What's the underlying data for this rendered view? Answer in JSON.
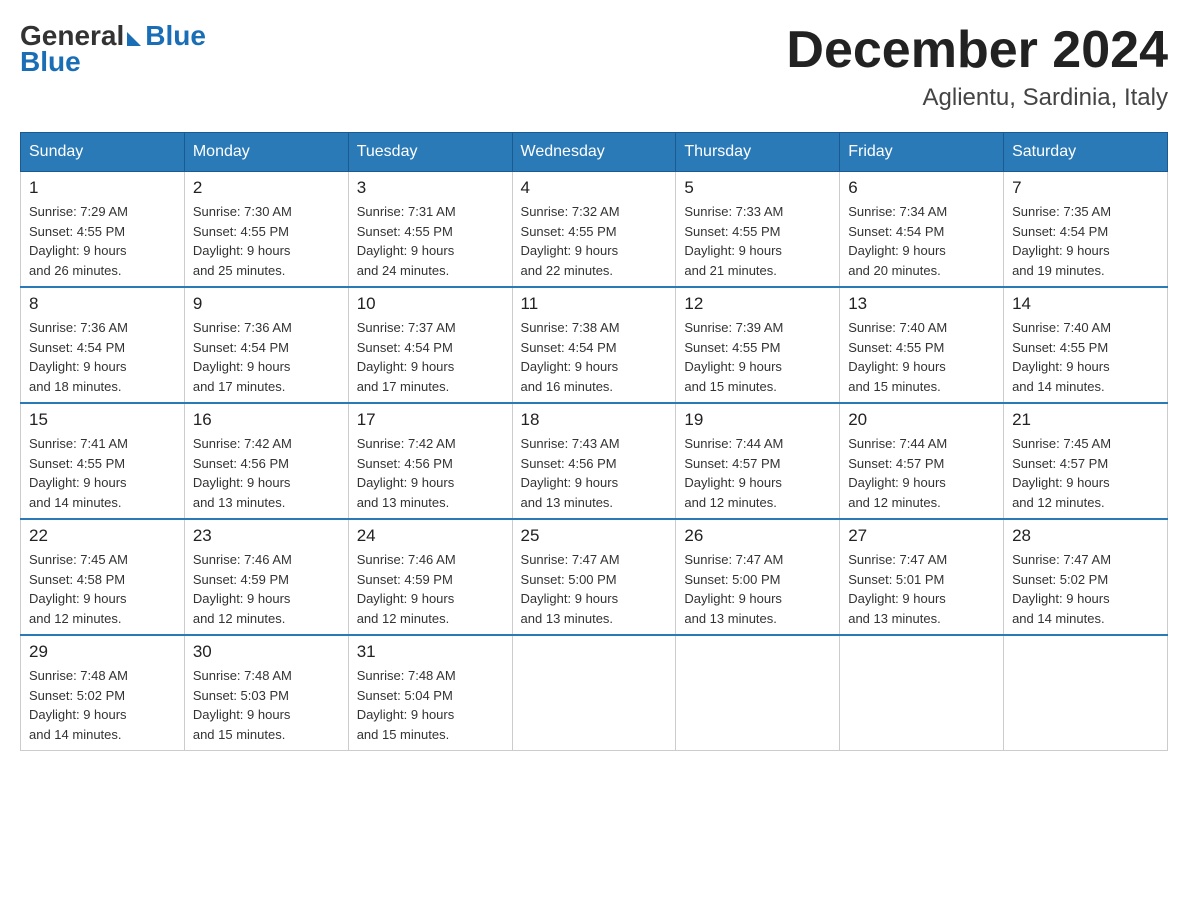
{
  "logo": {
    "general": "General",
    "blue": "Blue"
  },
  "header": {
    "month": "December 2024",
    "location": "Aglientu, Sardinia, Italy"
  },
  "days_of_week": [
    "Sunday",
    "Monday",
    "Tuesday",
    "Wednesday",
    "Thursday",
    "Friday",
    "Saturday"
  ],
  "weeks": [
    [
      {
        "day": "1",
        "sunrise": "7:29 AM",
        "sunset": "4:55 PM",
        "daylight": "9 hours and 26 minutes."
      },
      {
        "day": "2",
        "sunrise": "7:30 AM",
        "sunset": "4:55 PM",
        "daylight": "9 hours and 25 minutes."
      },
      {
        "day": "3",
        "sunrise": "7:31 AM",
        "sunset": "4:55 PM",
        "daylight": "9 hours and 24 minutes."
      },
      {
        "day": "4",
        "sunrise": "7:32 AM",
        "sunset": "4:55 PM",
        "daylight": "9 hours and 22 minutes."
      },
      {
        "day": "5",
        "sunrise": "7:33 AM",
        "sunset": "4:55 PM",
        "daylight": "9 hours and 21 minutes."
      },
      {
        "day": "6",
        "sunrise": "7:34 AM",
        "sunset": "4:54 PM",
        "daylight": "9 hours and 20 minutes."
      },
      {
        "day": "7",
        "sunrise": "7:35 AM",
        "sunset": "4:54 PM",
        "daylight": "9 hours and 19 minutes."
      }
    ],
    [
      {
        "day": "8",
        "sunrise": "7:36 AM",
        "sunset": "4:54 PM",
        "daylight": "9 hours and 18 minutes."
      },
      {
        "day": "9",
        "sunrise": "7:36 AM",
        "sunset": "4:54 PM",
        "daylight": "9 hours and 17 minutes."
      },
      {
        "day": "10",
        "sunrise": "7:37 AM",
        "sunset": "4:54 PM",
        "daylight": "9 hours and 17 minutes."
      },
      {
        "day": "11",
        "sunrise": "7:38 AM",
        "sunset": "4:54 PM",
        "daylight": "9 hours and 16 minutes."
      },
      {
        "day": "12",
        "sunrise": "7:39 AM",
        "sunset": "4:55 PM",
        "daylight": "9 hours and 15 minutes."
      },
      {
        "day": "13",
        "sunrise": "7:40 AM",
        "sunset": "4:55 PM",
        "daylight": "9 hours and 15 minutes."
      },
      {
        "day": "14",
        "sunrise": "7:40 AM",
        "sunset": "4:55 PM",
        "daylight": "9 hours and 14 minutes."
      }
    ],
    [
      {
        "day": "15",
        "sunrise": "7:41 AM",
        "sunset": "4:55 PM",
        "daylight": "9 hours and 14 minutes."
      },
      {
        "day": "16",
        "sunrise": "7:42 AM",
        "sunset": "4:56 PM",
        "daylight": "9 hours and 13 minutes."
      },
      {
        "day": "17",
        "sunrise": "7:42 AM",
        "sunset": "4:56 PM",
        "daylight": "9 hours and 13 minutes."
      },
      {
        "day": "18",
        "sunrise": "7:43 AM",
        "sunset": "4:56 PM",
        "daylight": "9 hours and 13 minutes."
      },
      {
        "day": "19",
        "sunrise": "7:44 AM",
        "sunset": "4:57 PM",
        "daylight": "9 hours and 12 minutes."
      },
      {
        "day": "20",
        "sunrise": "7:44 AM",
        "sunset": "4:57 PM",
        "daylight": "9 hours and 12 minutes."
      },
      {
        "day": "21",
        "sunrise": "7:45 AM",
        "sunset": "4:57 PM",
        "daylight": "9 hours and 12 minutes."
      }
    ],
    [
      {
        "day": "22",
        "sunrise": "7:45 AM",
        "sunset": "4:58 PM",
        "daylight": "9 hours and 12 minutes."
      },
      {
        "day": "23",
        "sunrise": "7:46 AM",
        "sunset": "4:59 PM",
        "daylight": "9 hours and 12 minutes."
      },
      {
        "day": "24",
        "sunrise": "7:46 AM",
        "sunset": "4:59 PM",
        "daylight": "9 hours and 12 minutes."
      },
      {
        "day": "25",
        "sunrise": "7:47 AM",
        "sunset": "5:00 PM",
        "daylight": "9 hours and 13 minutes."
      },
      {
        "day": "26",
        "sunrise": "7:47 AM",
        "sunset": "5:00 PM",
        "daylight": "9 hours and 13 minutes."
      },
      {
        "day": "27",
        "sunrise": "7:47 AM",
        "sunset": "5:01 PM",
        "daylight": "9 hours and 13 minutes."
      },
      {
        "day": "28",
        "sunrise": "7:47 AM",
        "sunset": "5:02 PM",
        "daylight": "9 hours and 14 minutes."
      }
    ],
    [
      {
        "day": "29",
        "sunrise": "7:48 AM",
        "sunset": "5:02 PM",
        "daylight": "9 hours and 14 minutes."
      },
      {
        "day": "30",
        "sunrise": "7:48 AM",
        "sunset": "5:03 PM",
        "daylight": "9 hours and 15 minutes."
      },
      {
        "day": "31",
        "sunrise": "7:48 AM",
        "sunset": "5:04 PM",
        "daylight": "9 hours and 15 minutes."
      },
      null,
      null,
      null,
      null
    ]
  ],
  "labels": {
    "sunrise": "Sunrise:",
    "sunset": "Sunset:",
    "daylight": "Daylight:"
  }
}
